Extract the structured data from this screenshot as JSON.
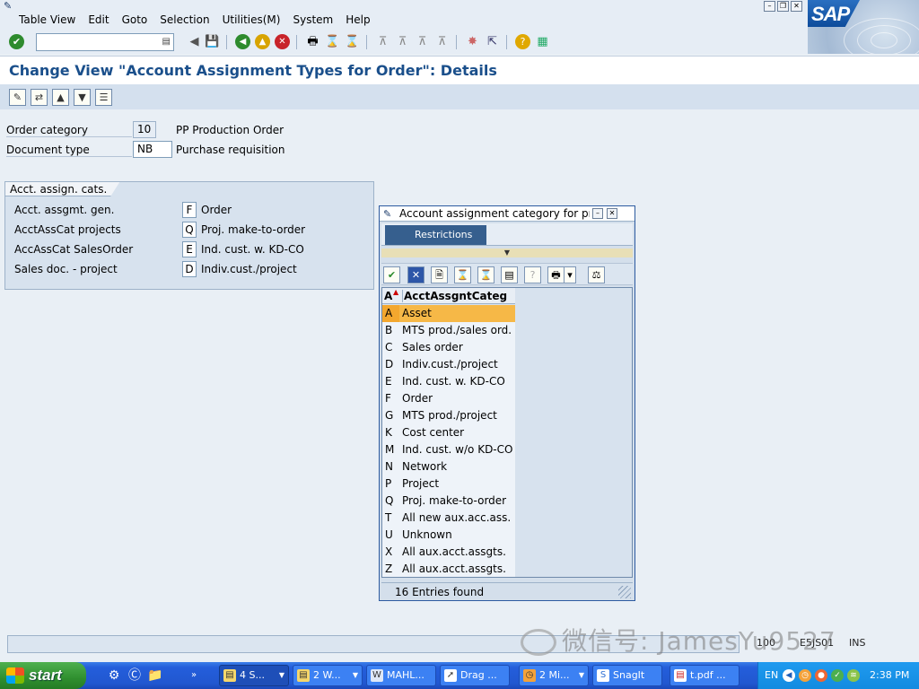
{
  "menubar": {
    "items": [
      "Table View",
      "Edit",
      "Goto",
      "Selection",
      "Utilities(M)",
      "System",
      "Help"
    ],
    "window_controls": [
      "minimize",
      "restore",
      "close"
    ],
    "logo_text": "SAP"
  },
  "toolbar": {
    "command_field": {
      "value": "",
      "placeholder": ""
    }
  },
  "title": "Change View \"Account Assignment Types for Order\": Details",
  "header_fields": {
    "order_category": {
      "label": "Order category",
      "value": "10",
      "description": "PP Production Order"
    },
    "document_type": {
      "label": "Document type",
      "value": "NB",
      "description": "Purchase requisition"
    }
  },
  "acct_assign_cats": {
    "group_title": "Acct. assign. cats.",
    "rows": [
      {
        "label": "Acct. assgmt. gen.",
        "value": "F",
        "description": "Order"
      },
      {
        "label": "AcctAssCat projects",
        "value": "Q",
        "description": "Proj. make-to-order"
      },
      {
        "label": "AccAssCat SalesOrder",
        "value": "E",
        "description": "Ind. cust. w. KD-CO"
      },
      {
        "label": "Sales doc. - project",
        "value": "D",
        "description": "Indiv.cust./project"
      }
    ]
  },
  "popup": {
    "title": "Account assignment category for pro...",
    "tab": "Restrictions",
    "columns": {
      "key": "A",
      "description": "AcctAssgntCateg"
    },
    "rows": [
      {
        "key": "A",
        "description": "Asset"
      },
      {
        "key": "B",
        "description": "MTS prod./sales ord."
      },
      {
        "key": "C",
        "description": "Sales order"
      },
      {
        "key": "D",
        "description": "Indiv.cust./project"
      },
      {
        "key": "E",
        "description": "Ind. cust. w. KD-CO"
      },
      {
        "key": "F",
        "description": "Order"
      },
      {
        "key": "G",
        "description": "MTS prod./project"
      },
      {
        "key": "K",
        "description": "Cost center"
      },
      {
        "key": "M",
        "description": "Ind. cust. w/o KD-CO"
      },
      {
        "key": "N",
        "description": "Network"
      },
      {
        "key": "P",
        "description": "Project"
      },
      {
        "key": "Q",
        "description": "Proj. make-to-order"
      },
      {
        "key": "T",
        "description": "All new aux.acc.ass."
      },
      {
        "key": "U",
        "description": "Unknown"
      },
      {
        "key": "X",
        "description": "All aux.acct.assgts."
      },
      {
        "key": "Z",
        "description": "All aux.acct.assgts."
      }
    ],
    "selected_key": "A",
    "status": "16 Entries found"
  },
  "statusbar": {
    "client": "100",
    "server": "E5JS01",
    "mode": "INS"
  },
  "watermark": "微信号: JamesYu9527",
  "taskbar": {
    "start_label": "start",
    "tasks": [
      {
        "label": "4 S...",
        "has_menu": true
      },
      {
        "label": "2 W...",
        "has_menu": true
      },
      {
        "label": "MAHL...",
        "has_menu": false
      },
      {
        "label": "Drag ...",
        "has_menu": false
      },
      {
        "label": "2 Mi...",
        "has_menu": true
      },
      {
        "label": "SnagIt",
        "has_menu": false
      },
      {
        "label": "t.pdf ...",
        "has_menu": false
      }
    ],
    "language": "EN",
    "clock": "2:38 PM"
  },
  "colors": {
    "title_blue": "#1a4f8b",
    "selected_row": "#f6b847",
    "tab_active": "#365f8e",
    "taskbar_blue": "#245edb",
    "start_green": "#2f8f2f"
  }
}
